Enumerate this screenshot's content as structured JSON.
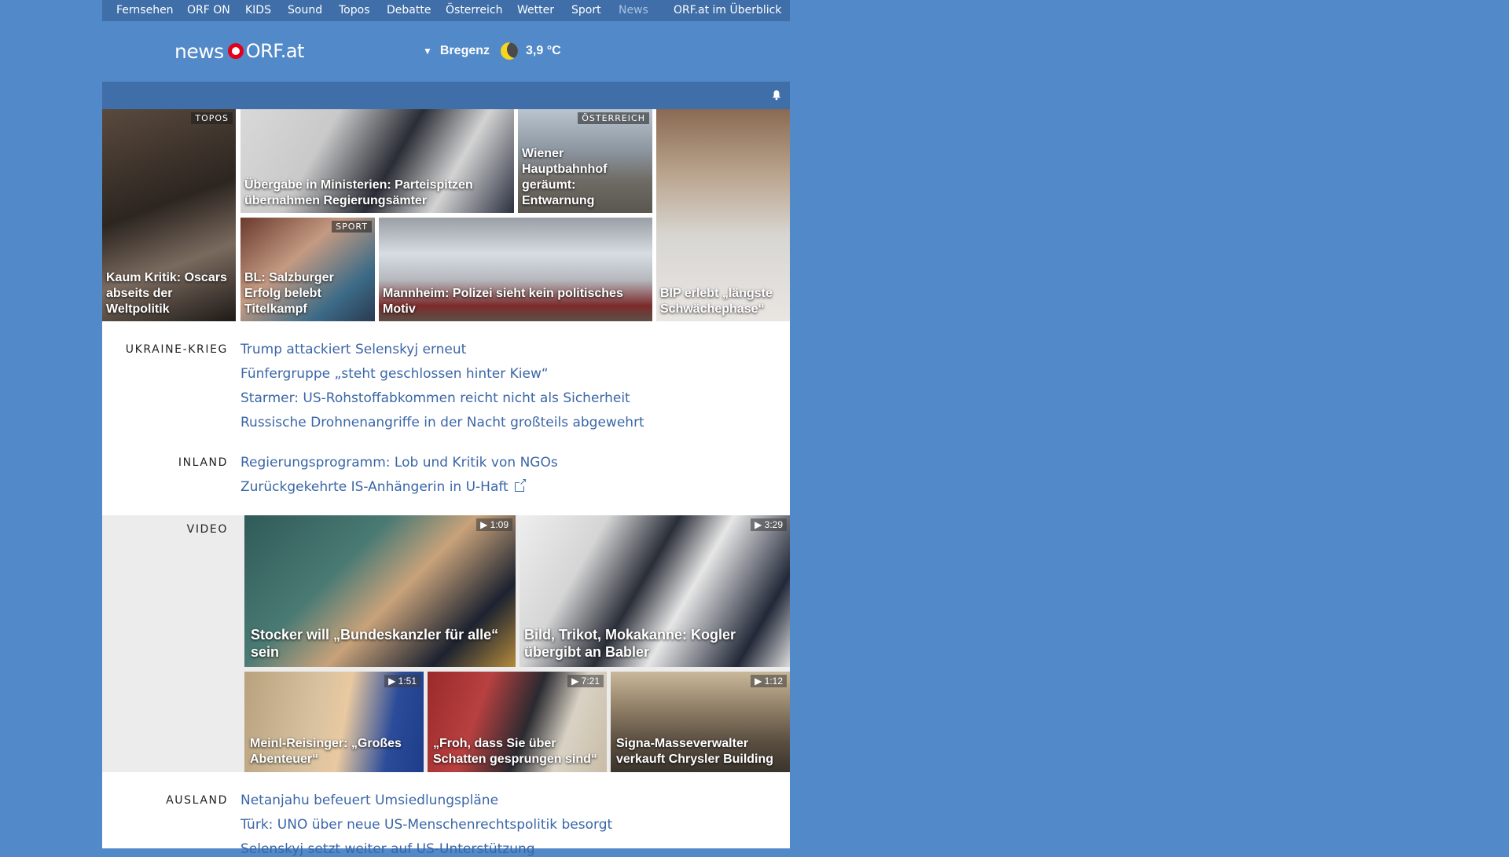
{
  "nav": {
    "items": [
      {
        "label": "Fernsehen"
      },
      {
        "label": "ORF ON"
      },
      {
        "label": "KIDS"
      },
      {
        "label": "Sound"
      },
      {
        "label": "Topos"
      },
      {
        "label": "Debatte"
      },
      {
        "label": "Österreich"
      },
      {
        "label": "Wetter"
      },
      {
        "label": "Sport"
      },
      {
        "label": "News"
      },
      {
        "label": "ORF.at im Überblick"
      }
    ]
  },
  "header": {
    "logo_news": "news",
    "logo_orf": "ORF.at",
    "weather_city": "Bregenz",
    "weather_temp": "3,9 °C",
    "weather_icon": "moon-icon"
  },
  "colors": {
    "background": "#5289c9",
    "nav": "#3f6ea8",
    "link": "#3a66a7",
    "brand_red": "#e2001a"
  },
  "topstories": [
    {
      "tag": "TOPOS",
      "caption": "Kaum Kritik: Oscars abseits der Weltpolitik"
    },
    {
      "tag": "",
      "caption": "Übergabe in Ministerien: Parteispitzen übernahmen Regierungsämter"
    },
    {
      "tag": "ÖSTERREICH",
      "caption": "Wiener Hauptbahnhof geräumt: Entwarnung"
    },
    {
      "tag": "",
      "caption": "BIP erlebt „längste Schwächephase“"
    },
    {
      "tag": "SPORT",
      "caption": "BL: Salzburger Erfolg belebt Titelkampf"
    },
    {
      "tag": "",
      "caption": "Mannheim: Polizei sieht kein politisches Motiv"
    }
  ],
  "sections": {
    "ukraine": {
      "label": "UKRAINE-KRIEG",
      "links": [
        "Trump attackiert Selenskyj erneut",
        "Fünfergruppe „steht geschlossen hinter Kiew“",
        "Starmer: US-Rohstoffabkommen reicht nicht als Sicherheit",
        "Russische Drohnenangriffe in der Nacht großteils abgewehrt"
      ]
    },
    "inland": {
      "label": "INLAND",
      "links": [
        "Regierungsprogramm: Lob und Kritik von NGOs",
        "Zurückgekehrte IS-Anhängerin in U-Haft"
      ]
    },
    "video": {
      "label": "VIDEO",
      "items": [
        {
          "duration": "1:09",
          "caption": "Stocker will „Bundeskanzler für alle“ sein"
        },
        {
          "duration": "3:29",
          "caption": "Bild, Trikot, Mokakanne: Kogler übergibt an Babler"
        },
        {
          "duration": "1:51",
          "caption": "Meinl-Reisinger: „Großes Abenteuer“"
        },
        {
          "duration": "7:21",
          "caption": "„Froh, dass Sie über Schatten gesprungen sind“"
        },
        {
          "duration": "1:12",
          "caption": "Signa-Masseverwalter verkauft Chrysler Building"
        }
      ]
    },
    "ausland": {
      "label": "AUSLAND",
      "links": [
        "Netanjahu befeuert Umsiedlungspläne",
        "Türk: UNO über neue US-Menschenrechtspolitik besorgt",
        "Selenskyj setzt weiter auf US-Unterstützung"
      ]
    }
  }
}
